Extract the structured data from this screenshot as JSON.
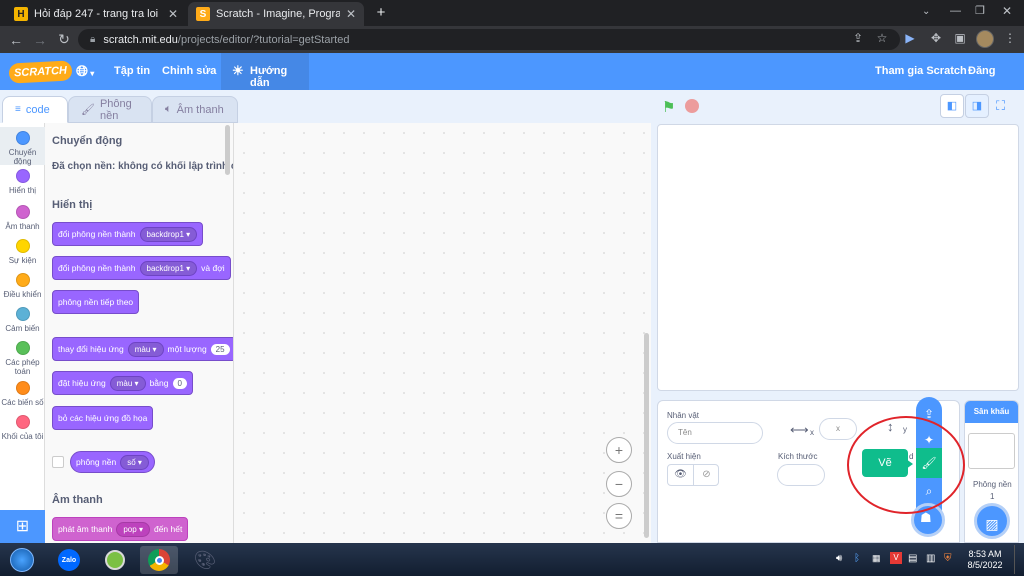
{
  "browser": {
    "tabs": [
      {
        "title": "Hỏi đáp 247 - trang tra loi",
        "favicon": "H"
      },
      {
        "title": "Scratch - Imagine, Program, Shar",
        "favicon": "S"
      }
    ],
    "new_tab_glyph": "+",
    "url_host": "scratch.mit.edu",
    "url_path": "/projects/editor/?tutorial=getStarted"
  },
  "menu": {
    "logo": "SCRATCH",
    "file": "Tập tin",
    "edit": "Chỉnh sửa",
    "tutorials": "Hướng dẫn",
    "join": "Tham gia Scratch",
    "signin": "Đăng nhập"
  },
  "editor_tabs": {
    "code": "code",
    "backdrops": "Phông nền",
    "sounds": "Âm thanh"
  },
  "categories": [
    {
      "label": "Chuyển động",
      "color": "#4c97ff"
    },
    {
      "label": "Hiển thị",
      "color": "#9966ff"
    },
    {
      "label": "Âm thanh",
      "color": "#cf63cf"
    },
    {
      "label": "Sự kiện",
      "color": "#ffd500"
    },
    {
      "label": "Điều khiển",
      "color": "#ffab19"
    },
    {
      "label": "Cảm biến",
      "color": "#5cb1d6"
    },
    {
      "label": "Các phép toán",
      "color": "#59c059"
    },
    {
      "label": "Các biến số",
      "color": "#ff8c1a"
    },
    {
      "label": "Khối của tôi",
      "color": "#ff6680"
    }
  ],
  "palette": {
    "motion_heading": "Chuyển động",
    "motion_note": "Đã chọn nền: không có khối lập trình c",
    "looks_heading": "Hiển thị",
    "sound_heading": "Âm thanh",
    "blocks": {
      "switch_backdrop": {
        "text": "đổi phông nền thành",
        "value": "backdrop1"
      },
      "switch_backdrop_wait": {
        "text": "đổi phông nền thành",
        "value": "backdrop1",
        "suffix": "và đợi"
      },
      "next_backdrop": {
        "text": "phông nền tiếp theo"
      },
      "change_effect": {
        "text": "thay đổi hiệu ứng",
        "value": "màu",
        "mid": "một lượng",
        "num": "25"
      },
      "set_effect": {
        "text": "đặt hiệu ứng",
        "value": "màu",
        "mid": "bằng",
        "num": "0"
      },
      "clear_effects": {
        "text": "bỏ các hiệu ứng đồ họa"
      },
      "backdrop_reporter": {
        "text": "phông nền",
        "value": "số"
      },
      "play_sound": {
        "text": "phát âm thanh",
        "value": "pop",
        "suffix": "đến hết"
      }
    }
  },
  "zoom": {
    "in": "+",
    "out": "−",
    "reset": "="
  },
  "sprite_info": {
    "sprite_label": "Nhân vật",
    "name_placeholder": "Tên",
    "x_label": "x",
    "x_placeholder": "x",
    "y_label": "y",
    "show_label": "Xuất hiện",
    "size_label": "Kích thước",
    "direction_partial": "d"
  },
  "stage_panel": {
    "header": "Sân khấu",
    "backdrops_label": "Phông nền",
    "backdrops_count": "1"
  },
  "paint_tooltip": "Vẽ",
  "taskbar": {
    "time": "8:53 AM",
    "date": "8/5/2022",
    "zalo": "Zalo"
  },
  "colors": {
    "scratch_blue": "#4c97ff",
    "looks": "#9966ff",
    "sound": "#cf63cf",
    "paint_green": "#0fbd8c",
    "annotation_red": "#e0242a"
  }
}
